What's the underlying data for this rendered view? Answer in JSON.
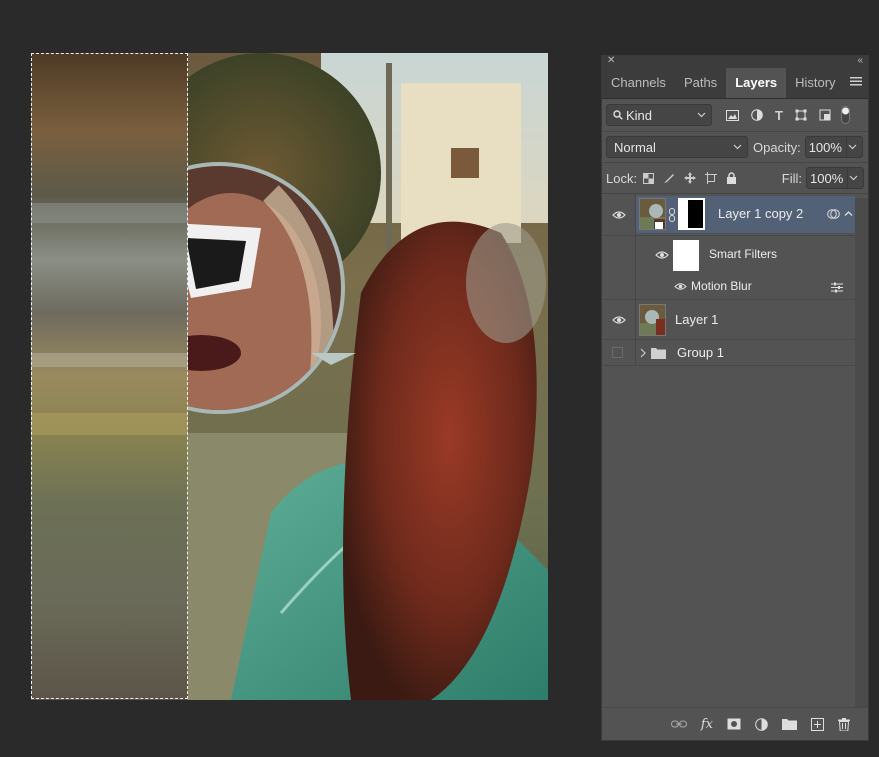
{
  "panel": {
    "tabs": [
      {
        "label": "Channels",
        "active": false
      },
      {
        "label": "Paths",
        "active": false
      },
      {
        "label": "Layers",
        "active": true
      },
      {
        "label": "History",
        "active": false
      }
    ],
    "filter": {
      "kind_label": "Kind"
    },
    "blend_mode": "Normal",
    "opacity_label": "Opacity:",
    "opacity_value": "100%",
    "lock_label": "Lock:",
    "fill_label": "Fill:",
    "fill_value": "100%",
    "layers": [
      {
        "name": "Layer 1 copy 2",
        "visible": true,
        "selected": true,
        "type": "smart-object-with-mask"
      },
      {
        "name": "Smart Filters",
        "visible": true,
        "type": "smart-filters"
      },
      {
        "name": "Motion Blur",
        "visible": true,
        "type": "filter"
      },
      {
        "name": "Layer 1",
        "visible": true,
        "type": "pixel"
      },
      {
        "name": "Group 1",
        "visible": false,
        "type": "group",
        "expanded": false
      }
    ]
  },
  "colors": {
    "app_bg": "#2a2a2a",
    "panel_bg": "#535353",
    "selected_layer": "#536176",
    "tab_bar": "#3c3c3c"
  }
}
